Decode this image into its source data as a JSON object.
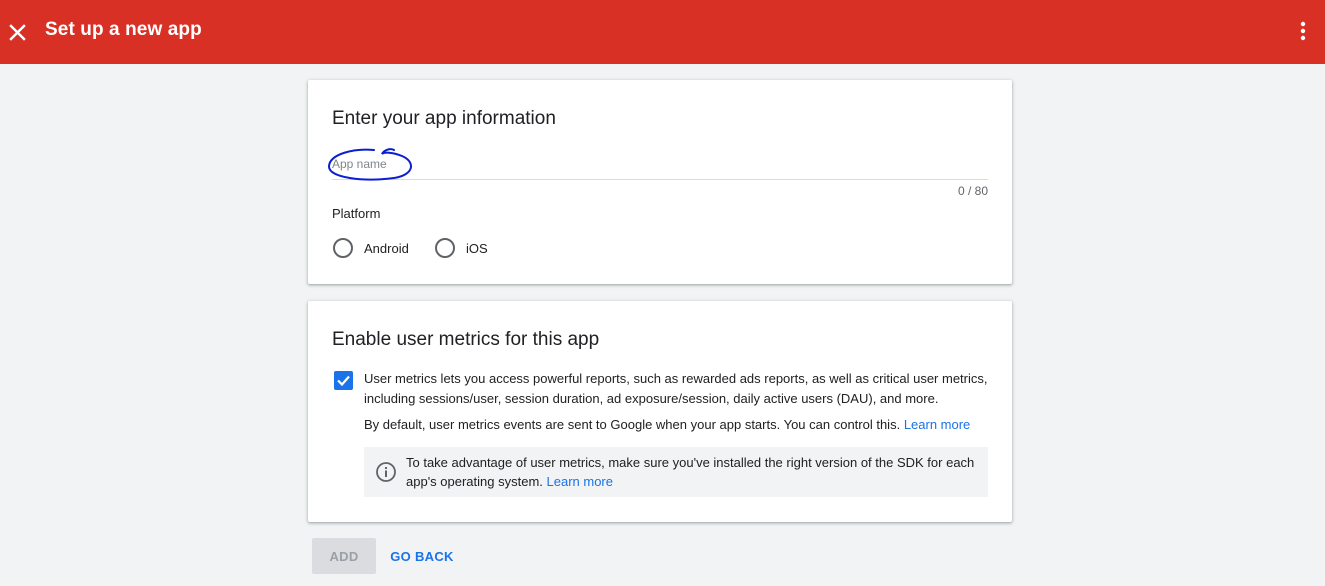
{
  "header": {
    "title": "Set up a new app",
    "close_icon": "close-icon",
    "more_icon": "more-vert-icon",
    "background_color": "#d93025"
  },
  "app_info": {
    "title": "Enter your app information",
    "app_name_placeholder": "App name",
    "app_name_value": "",
    "char_counter": "0 / 80",
    "platform_label": "Platform",
    "platform_options": [
      {
        "label": "Android",
        "selected": false
      },
      {
        "label": "iOS",
        "selected": false
      }
    ]
  },
  "user_metrics": {
    "title": "Enable user metrics for this app",
    "checked": true,
    "description": "User metrics lets you access powerful reports, such as rewarded ads reports, as well as critical user metrics, including sessions/user, session duration, ad exposure/session, daily active users (DAU), and more.",
    "default_note": "By default, user metrics events are sent to Google when your app starts. You can control this.",
    "default_note_link": "Learn more",
    "info_text": "To take advantage of user metrics, make sure you've installed the right version of the SDK for each app's operating system.",
    "info_link": "Learn more",
    "info_icon": "info-icon"
  },
  "actions": {
    "add_label": "ADD",
    "add_disabled": true,
    "go_back_label": "GO BACK"
  },
  "colors": {
    "accent": "#1a73e8",
    "annotation": "#0b1fd1"
  }
}
